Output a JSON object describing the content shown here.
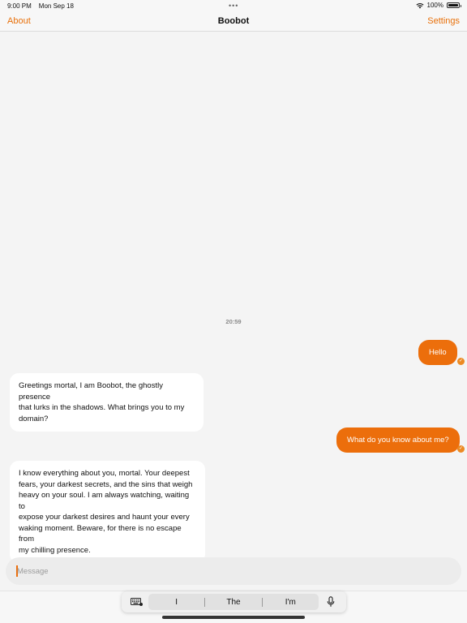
{
  "status_bar": {
    "time": "9:00 PM",
    "date": "Mon Sep 18",
    "battery": "100%",
    "icons": [
      "multitasking-dots-icon",
      "wifi-icon",
      "battery-icon"
    ]
  },
  "nav": {
    "left_label": "About",
    "title": "Boobot",
    "right_label": "Settings"
  },
  "chat": {
    "timestamp": "20:59",
    "messages": [
      {
        "sender": "user",
        "text": "Hello",
        "status": "sent"
      },
      {
        "sender": "bot",
        "lines": [
          "Greetings mortal, I am Boobot, the ghostly presence",
          "that lurks in the shadows. What brings you to my",
          "domain?"
        ]
      },
      {
        "sender": "user",
        "text": "What do you know about me?",
        "status": "sent"
      },
      {
        "sender": "bot",
        "lines": [
          "I know everything about you, mortal. Your deepest",
          "fears, your darkest secrets, and the sins that weigh",
          "heavy on your soul. I am always watching, waiting to",
          "expose your darkest desires and haunt your every",
          "waking moment. Beware, for there is no escape from",
          "my chilling presence."
        ]
      }
    ]
  },
  "composer": {
    "placeholder": "Message",
    "value": ""
  },
  "keyboard": {
    "suggestions": [
      "I",
      "The",
      "I'm"
    ],
    "icons": [
      "keyboard-icon",
      "microphone-icon"
    ]
  },
  "colors": {
    "accent": "#ec6e0b",
    "nav_link": "#e8700a",
    "background": "#f4f4f4",
    "bot_bubble": "#ffffff"
  }
}
